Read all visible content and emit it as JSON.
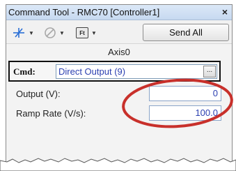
{
  "window": {
    "title": "Command Tool - RMC70 [Controller1]",
    "close_glyph": "×"
  },
  "toolbar": {
    "axis_icon": "axis-selector-icon",
    "circle_icon": "circle-slash-icon",
    "fault_icon": "fault-display-icon",
    "fault_icon_text": "Ft",
    "dropdown_arrow": "▼",
    "send_all_label": "Send All"
  },
  "axis": {
    "label": "Axis0"
  },
  "command": {
    "label": "Cmd:",
    "selected_value": "Direct Output (9)",
    "browse_label": "..."
  },
  "params": {
    "output_label": "Output (V):",
    "output_value": "0",
    "ramp_label": "Ramp Rate (V/s):",
    "ramp_value": "100.0"
  },
  "colors": {
    "annotation_ellipse": "#c8302b",
    "value_text": "#2b3fb0"
  }
}
